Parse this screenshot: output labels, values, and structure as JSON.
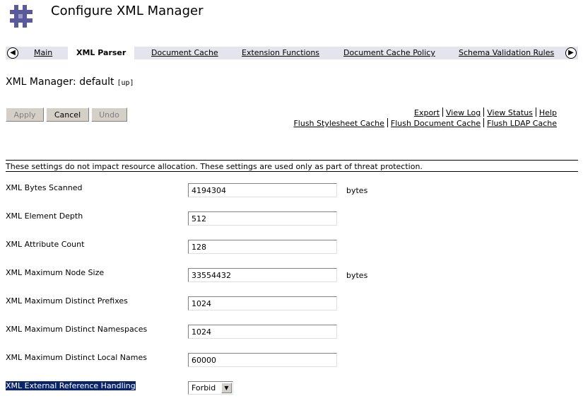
{
  "header": {
    "title": "Configure XML Manager"
  },
  "tabs": {
    "prev_icon": "arrow-left-circle",
    "next_icon": "arrow-right-circle",
    "items": [
      {
        "label": "Main"
      },
      {
        "label": "XML Parser",
        "active": true
      },
      {
        "label": "Document Cache"
      },
      {
        "label": "Extension Functions"
      },
      {
        "label": "Document Cache Policy"
      },
      {
        "label": "Schema Validation Rules"
      }
    ]
  },
  "manager": {
    "label": "XML Manager: default",
    "up": "[up]"
  },
  "buttons": {
    "apply": "Apply",
    "cancel": "Cancel",
    "undo": "Undo"
  },
  "links": {
    "row1": [
      "Export",
      "View Log",
      "View Status",
      "Help"
    ],
    "row2": [
      "Flush Stylesheet Cache",
      "Flush Document Cache",
      "Flush LDAP Cache"
    ]
  },
  "note": "These settings do not impact resource allocation. These settings are used only as part of threat protection.",
  "fields": [
    {
      "label": "XML Bytes Scanned",
      "value": "4194304",
      "unit": "bytes"
    },
    {
      "label": "XML Element Depth",
      "value": "512",
      "unit": ""
    },
    {
      "label": "XML Attribute Count",
      "value": "128",
      "unit": ""
    },
    {
      "label": "XML Maximum Node Size",
      "value": "33554432",
      "unit": "bytes"
    },
    {
      "label": "XML Maximum Distinct Prefixes",
      "value": "1024",
      "unit": ""
    },
    {
      "label": "XML Maximum Distinct Namespaces",
      "value": "1024",
      "unit": ""
    },
    {
      "label": "XML Maximum Distinct Local Names",
      "value": "60000",
      "unit": ""
    }
  ],
  "external_reference": {
    "label": "XML External Reference Handling",
    "value": "Forbid"
  },
  "colors": {
    "tabbar": "#e4e4ec",
    "highlight": "#0a246a",
    "logo": "#5a5a9a"
  }
}
